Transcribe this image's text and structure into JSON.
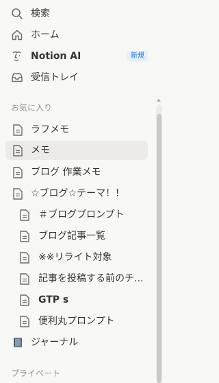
{
  "nav": {
    "search": "検索",
    "home": "ホーム",
    "notion_ai": "Notion AI",
    "notion_ai_badge": "新規",
    "inbox": "受信トレイ"
  },
  "favorites": {
    "header": "お気に入り",
    "items": [
      "ラフメモ",
      "メモ",
      "ブログ 作業メモ",
      "☆ブログ☆テーマ！！"
    ],
    "children": [
      "＃ブログプロンプト",
      "ブログ記事一覧",
      "※※リライト対象",
      "記事を投稿する前のチ...",
      "GTP s",
      "便利丸プロンプト"
    ],
    "journal": "ジャーナル"
  },
  "private": {
    "header": "プライベート"
  },
  "colors": {
    "badge_bg": "#e7f0fa",
    "badge_text": "#2b7bd1",
    "selected_bg": "#ecebea"
  }
}
